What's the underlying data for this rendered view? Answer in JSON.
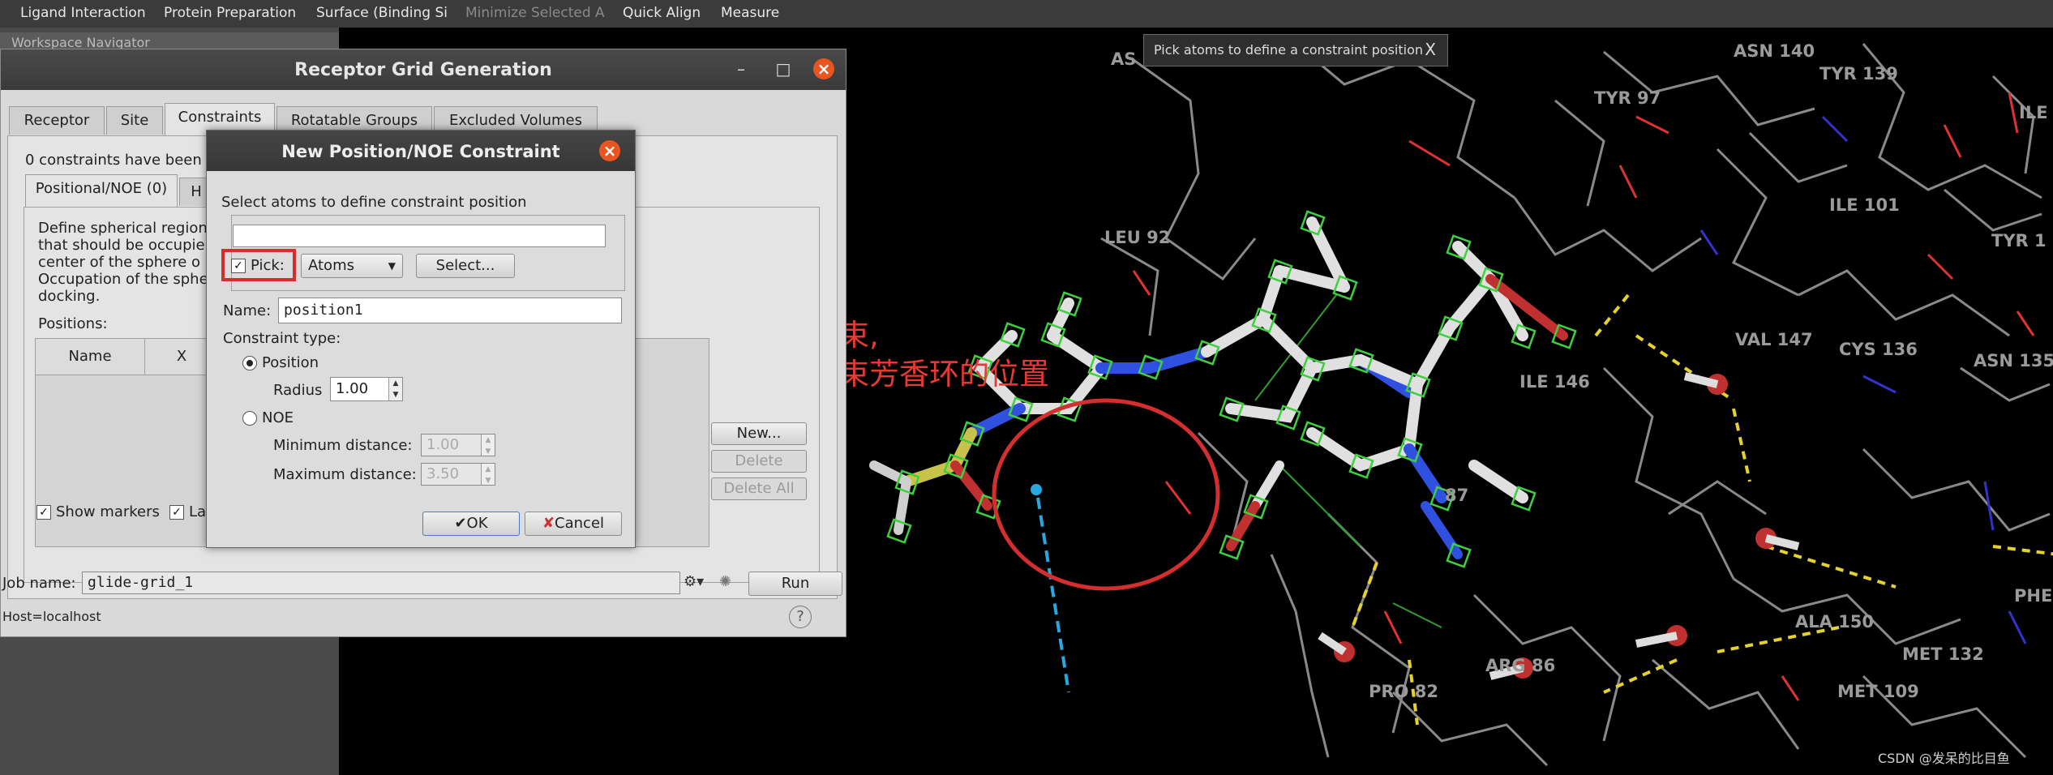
{
  "menubar": {
    "items": [
      "Ligand Interaction",
      "Protein Preparation",
      "Surface (Binding Si",
      "Minimize Selected A",
      "Quick Align",
      "Measure"
    ]
  },
  "workspace_navigator": {
    "label": "Workspace Navigator"
  },
  "tooltip": {
    "text": "Pick atoms to define a constraint position",
    "close": "X"
  },
  "annotation": {
    "line1": "位置约束,",
    "line2": "比如约束芳香环的位置",
    "color": "#e53935"
  },
  "watermark": "CSDN @发呆的比目鱼",
  "residues": [
    "ASN 140",
    "TYR 139",
    "TYR 97",
    "ILE",
    "ILE 101",
    "TYR 1",
    "LEU 92",
    "VAL 147",
    "CYS 136",
    "ASN 135",
    "ILE 146",
    "87",
    "PHE 1",
    "ALA 150",
    "MET 132",
    "PRO 82",
    "ARG 86",
    "MET 109",
    "AS"
  ],
  "receptor_window": {
    "title": "Receptor Grid Generation",
    "tabs": [
      "Receptor",
      "Site",
      "Constraints",
      "Rotatable Groups",
      "Excluded Volumes"
    ],
    "active_tab": "Constraints",
    "constraint_count": "0 constraints have been",
    "subtabs": [
      "Positional/NOE (0)",
      "H"
    ],
    "description": [
      "Define spherical region",
      "that should be occupie",
      "center of the sphere o",
      "Occupation of the sphe",
      "docking."
    ],
    "positions_label": "Positions:",
    "table_headers": [
      "Name",
      "X"
    ],
    "buttons": {
      "new": "New...",
      "delete": "Delete",
      "delete_all": "Delete All"
    },
    "show_markers": "Show markers",
    "label_checkbox": "La",
    "job_name_label": "Job name:",
    "job_name_value": "glide-grid_1",
    "run": "Run",
    "host": "Host=localhost",
    "help": "?"
  },
  "dialog": {
    "title": "New Position/NOE Constraint",
    "instruction": "Select atoms to define constraint position",
    "pick_label": "Pick:",
    "pick_checked": "✓",
    "pick_mode": "Atoms",
    "select_button": "Select...",
    "name_label": "Name:",
    "name_value": "position1",
    "constraint_type_label": "Constraint type:",
    "position_option": "Position",
    "radius_label": "Radius",
    "radius_value": "1.00",
    "noe_option": "NOE",
    "min_distance_label": "Minimum distance:",
    "min_distance_value": "1.00",
    "max_distance_label": "Maximum distance:",
    "max_distance_value": "3.50",
    "ok": "OK",
    "cancel": "Cancel",
    "selected_type": "Position"
  },
  "colors": {
    "highlight_red": "#d32f2f",
    "close_orange": "#e95420",
    "marker_green": "#3fcf3f"
  }
}
